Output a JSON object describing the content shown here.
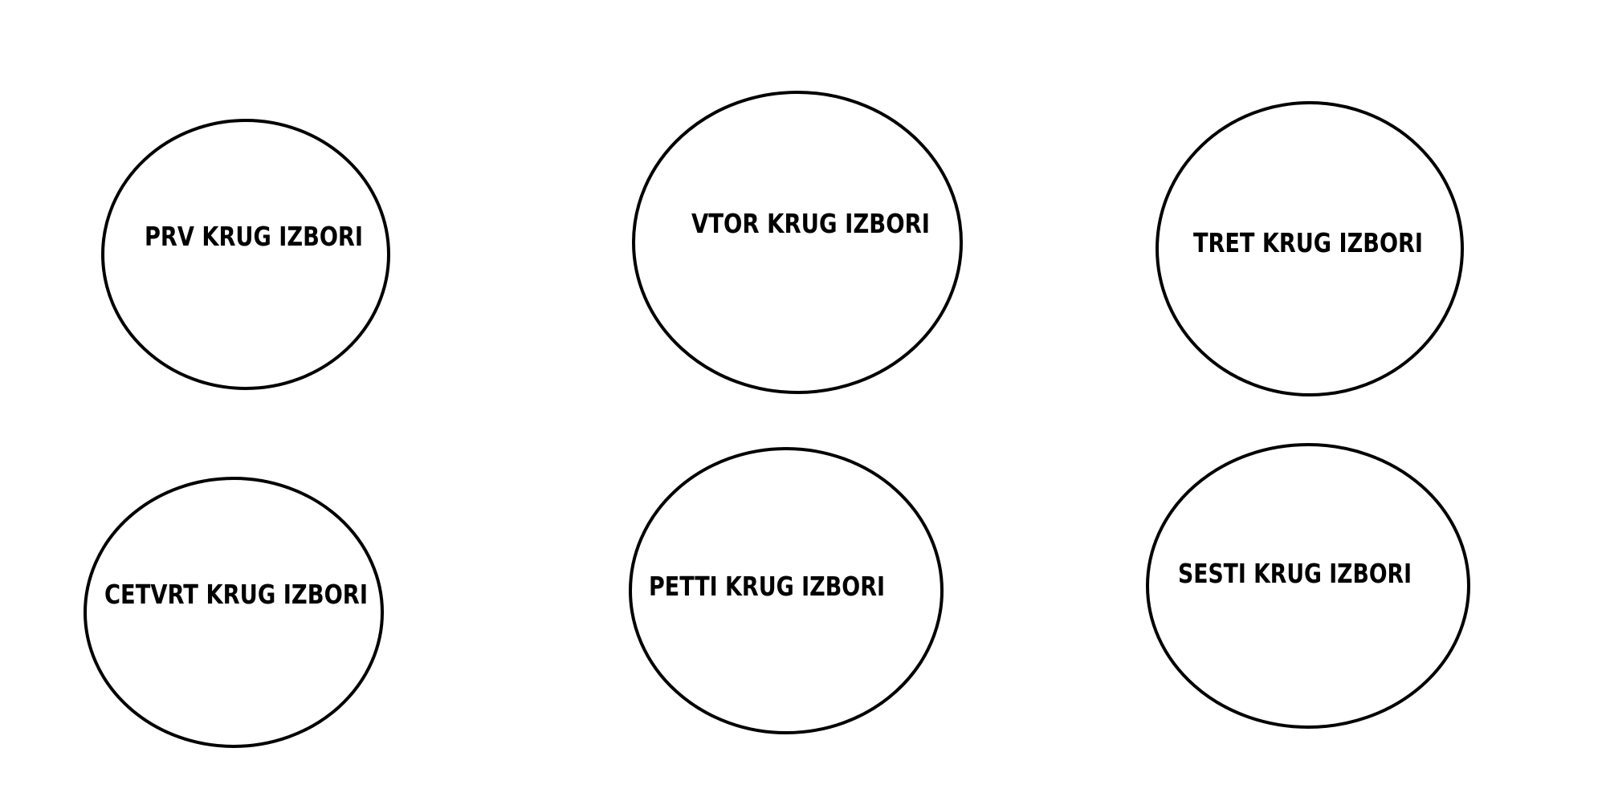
{
  "diagram": {
    "colors": {
      "background": "#ffffff",
      "stroke": "#000000",
      "text": "#000000"
    },
    "circles": [
      {
        "label": "PRV KRUG IZBORI"
      },
      {
        "label": "VTOR KRUG IZBORI"
      },
      {
        "label": "TRET KRUG IZBORI"
      },
      {
        "label": "CETVRT KRUG IZBORI"
      },
      {
        "label": "PETTI KRUG IZBORI"
      },
      {
        "label": "SESTI KRUG IZBORI"
      }
    ]
  }
}
